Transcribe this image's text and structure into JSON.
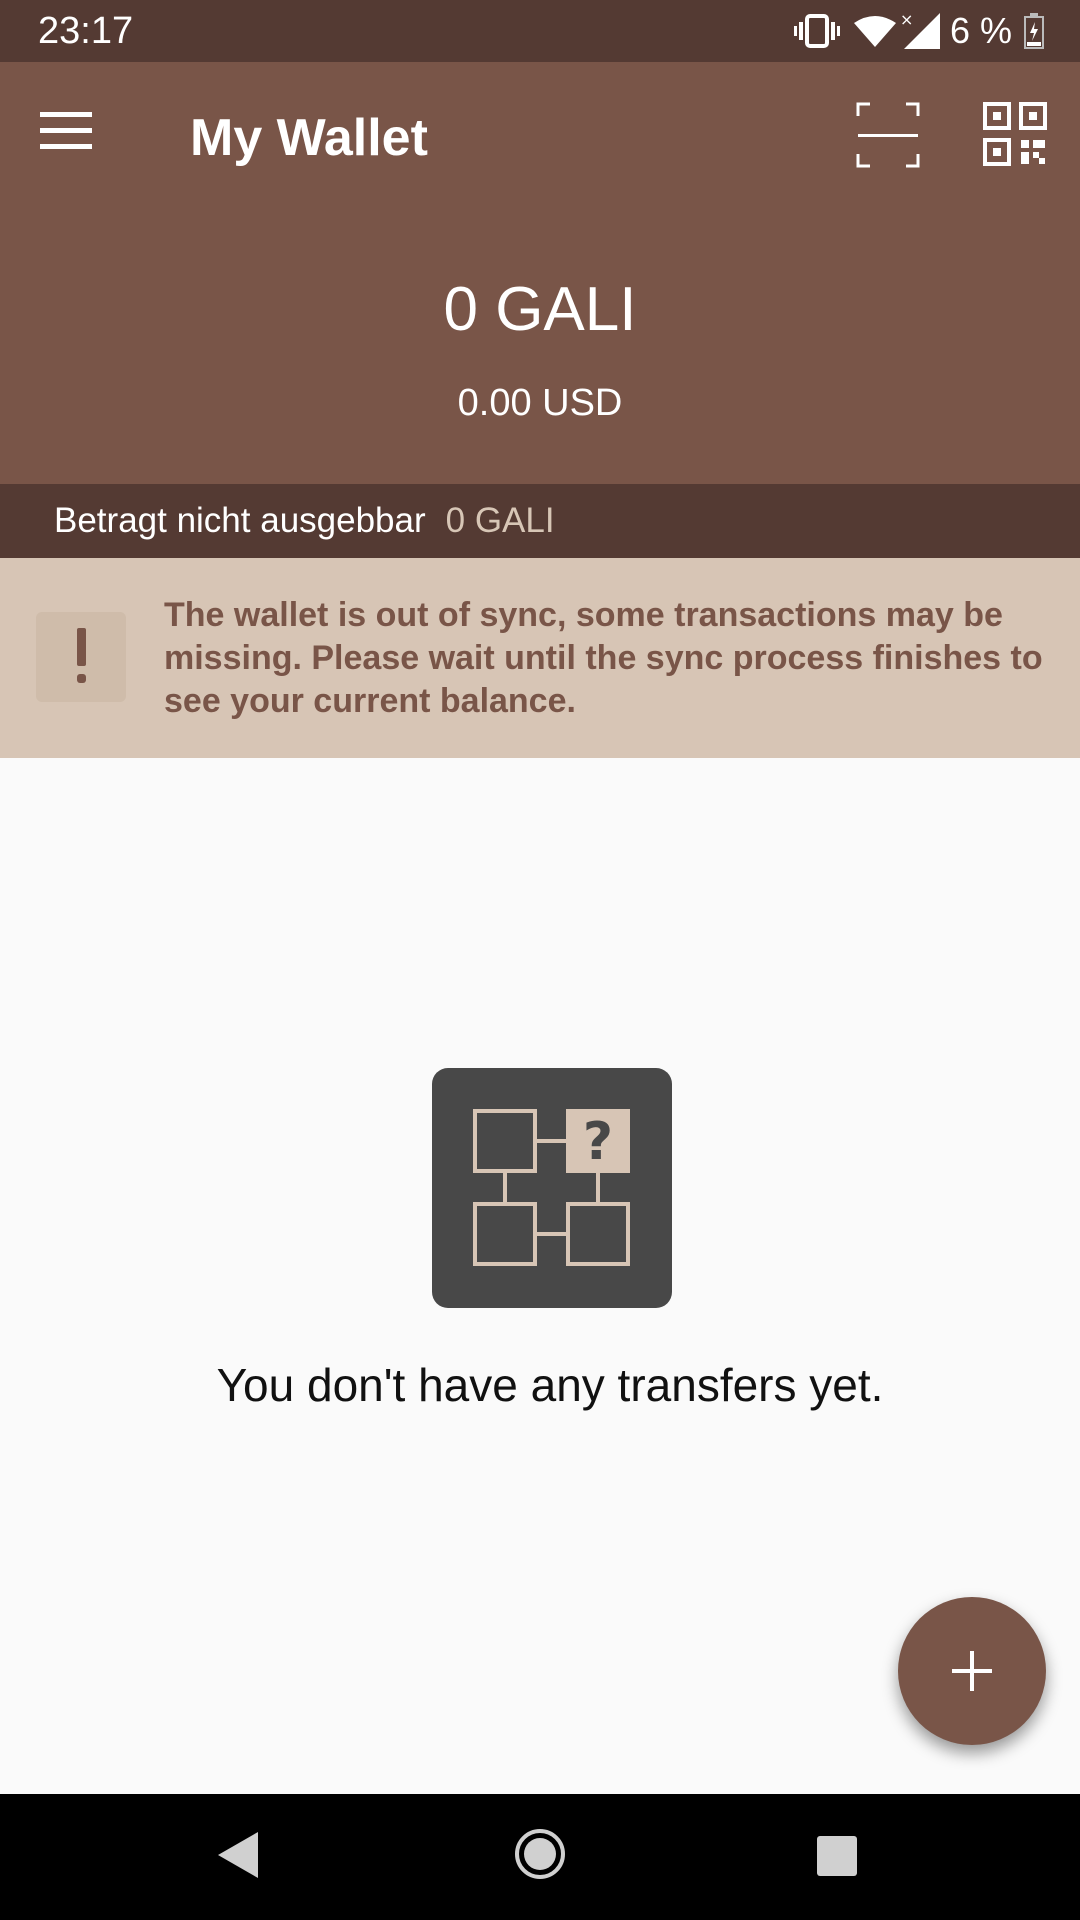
{
  "status_bar": {
    "time": "23:17",
    "battery_percent": "6 %",
    "icons": [
      "vibrate-icon",
      "wifi-icon",
      "signal-icon",
      "battery-charging-icon"
    ]
  },
  "app_bar": {
    "title": "My Wallet",
    "icons": [
      "menu-icon",
      "scan-icon",
      "qr-code-icon"
    ],
    "color": "#795548"
  },
  "balance": {
    "amount": "0 GALI",
    "fiat": "0.00 USD"
  },
  "unspendable": {
    "label": "Betragt nicht ausgebbar",
    "amount": "0 GALI"
  },
  "sync_warning": {
    "icon": "exclamation-icon",
    "message": "The wallet is out of sync, some transactions may be missing. Please wait until the sync process finishes to see your current balance."
  },
  "empty_state": {
    "icon": "blockchain-question-icon",
    "message": "You don't have any transfers yet."
  },
  "fab": {
    "icon": "plus-icon"
  },
  "nav_bar": {
    "icons": [
      "back-icon",
      "home-icon",
      "recents-icon"
    ]
  }
}
